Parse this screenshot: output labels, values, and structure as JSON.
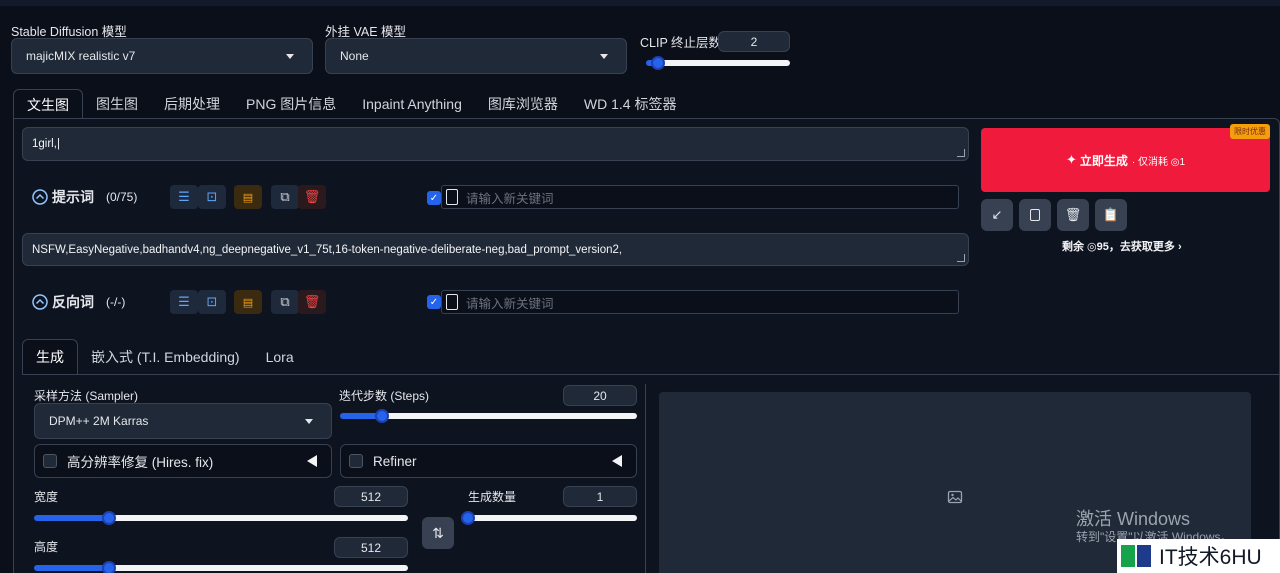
{
  "models": {
    "sd_label": "Stable Diffusion 模型",
    "sd_value": "majicMIX realistic v7",
    "vae_label": "外挂 VAE 模型",
    "vae_value": "None",
    "clip_label": "CLIP 终止层数",
    "clip_value": "2",
    "clip_fraction": 0.08
  },
  "tabs": [
    "文生图",
    "图生图",
    "后期处理",
    "PNG 图片信息",
    "Inpaint Anything",
    "图库浏览器",
    "WD 1.4 标签器"
  ],
  "prompt": {
    "text": "1girl,",
    "label": "提示词",
    "count": "(0/75)",
    "keyword_placeholder": "请输入新关键词"
  },
  "negative": {
    "text": "NSFW,EasyNegative,badhandv4,ng_deepnegative_v1_75t,16-token-negative-deliberate-neg,bad_prompt_version2,",
    "label": "反向词",
    "count": "(-/-)",
    "keyword_placeholder": "请输入新关键词"
  },
  "generate": {
    "badge": "限时优惠",
    "label": "立即生成",
    "cost": "· 仅消耗 ◎1",
    "remaining": "剩余 ◎95，去获取更多 ›"
  },
  "subtabs": [
    "生成",
    "嵌入式 (T.I. Embedding)",
    "Lora"
  ],
  "sampler": {
    "label": "采样方法 (Sampler)",
    "value": "DPM++ 2M Karras"
  },
  "steps": {
    "label": "迭代步数 (Steps)",
    "value": "20",
    "fraction": 0.14
  },
  "hires": {
    "label": "高分辨率修复 (Hires. fix)"
  },
  "refiner": {
    "label": "Refiner"
  },
  "width": {
    "label": "宽度",
    "value": "512",
    "fraction": 0.2
  },
  "height": {
    "label": "高度",
    "value": "512",
    "fraction": 0.2
  },
  "batch": {
    "label": "生成数量",
    "value": "1",
    "fraction": 0.0
  },
  "watermark": {
    "activate_title": "激活 Windows",
    "activate_sub": "转到\"设置\"以激活 Windows。",
    "site": "IT技术6HU"
  },
  "colors": {
    "accent": "#2563eb",
    "generate": "#f01a3c",
    "bg": "#0b0f19"
  }
}
